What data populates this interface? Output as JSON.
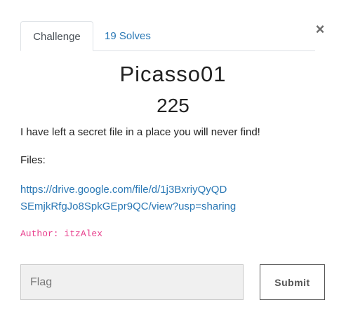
{
  "modal": {
    "close_symbol": "×",
    "close_icon": "close-icon"
  },
  "tabs": [
    {
      "label": "Challenge",
      "active": true
    },
    {
      "label": "19 Solves",
      "active": false
    }
  ],
  "challenge": {
    "name": "Picasso01",
    "value": "225",
    "description": "I have left a secret file in a place you will never find!",
    "files_label": "Files:",
    "file_link_line1": "https://drive.google.com/file/d/1j3BxriyQyQD",
    "file_link_line2": "SEmjkRfgJo8SpkGEpr9QC/view?usp=sharing",
    "author": "Author: itzAlex"
  },
  "form": {
    "flag_placeholder": "Flag",
    "flag_value": "",
    "submit_label": "Submit"
  },
  "colors": {
    "link": "#2a78b5",
    "author": "#e83e8c",
    "input_bg": "#f0f0f0"
  }
}
